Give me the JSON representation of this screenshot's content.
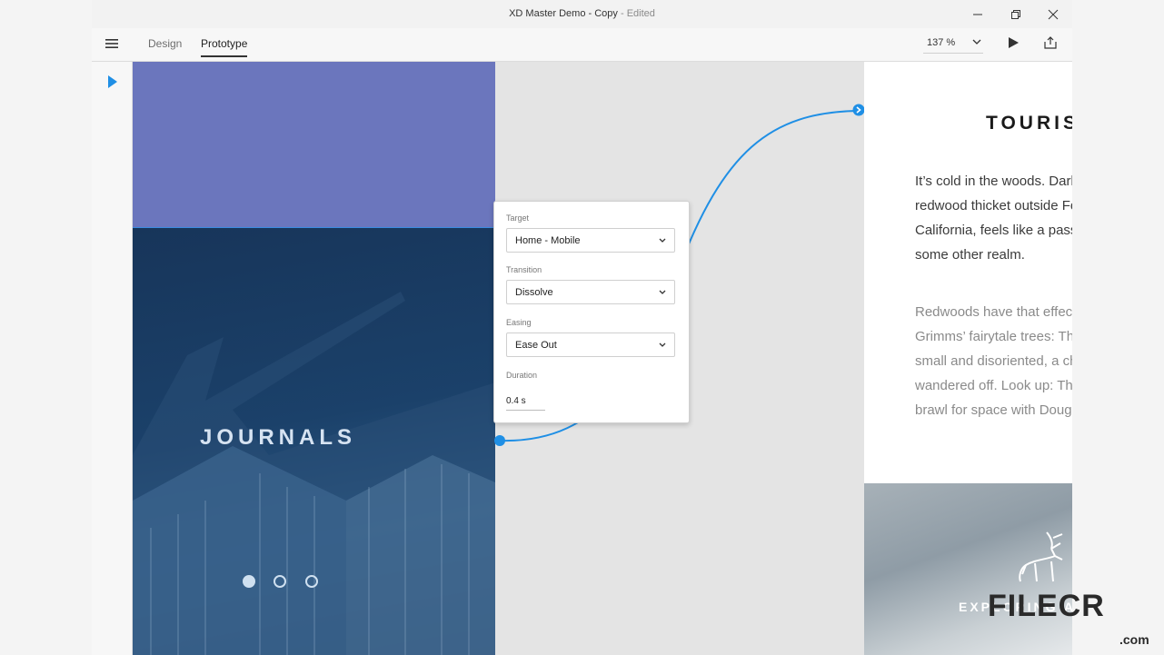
{
  "window": {
    "title": "XD Master Demo - Copy",
    "title_separator": " - ",
    "edited": "Edited",
    "controls": [
      "minimize-icon",
      "restore-icon",
      "close-icon"
    ]
  },
  "toolbar": {
    "tabs": [
      {
        "label": "Design",
        "active": false
      },
      {
        "label": "Prototype",
        "active": true
      }
    ],
    "zoom": "137 %",
    "icons": [
      "menu-icon",
      "chevron-down-icon",
      "play-icon",
      "share-icon"
    ]
  },
  "left_artboard": {
    "heading": "JOURNALS",
    "pagination_dots": 3,
    "active_dot": 0
  },
  "prototype_popover": {
    "target_label": "Target",
    "target_value": "Home - Mobile",
    "transition_label": "Transition",
    "transition_value": "Dissolve",
    "easing_label": "Easing",
    "easing_value": "Ease Out",
    "duration_label": "Duration",
    "duration_value": "0.4 s"
  },
  "right_artboard": {
    "heading": "TOURISM",
    "paragraph1": "It’s cold in the woods. Dark, too. This\nredwood thicket outside Fort Bragg,\nCalifornia, feels like a passageway to\nsome other realm.",
    "paragraph2": "Redwoods have that effect. They’re\nGrimms’ fairytale trees: They render you\nsmall and disoriented, a child who’s\nwandered off. Look up: Their branches\nbrawl for space with Douglas firs.",
    "banner_title": "EXPLORING ALASKA"
  },
  "watermark": {
    "text": "FILECR",
    "suffix": ".com"
  },
  "colors": {
    "accent": "#1f8fe5",
    "purple": "#6b76bd",
    "photo_blue": "#1c3a5a"
  }
}
